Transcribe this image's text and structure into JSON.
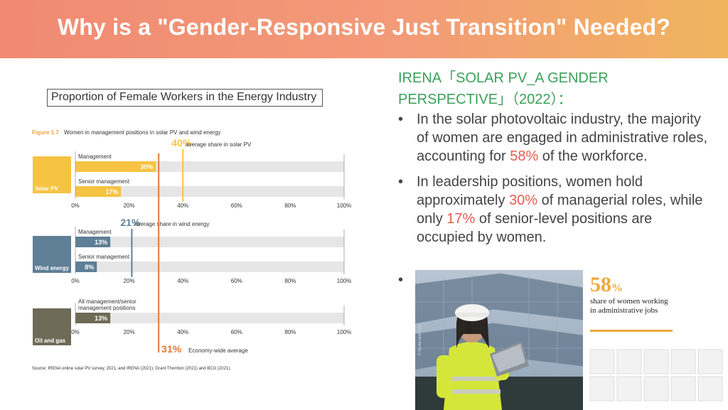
{
  "title": "Why is a \"Gender-Responsive Just Transition\" Needed?",
  "chart_box_title": "Proportion of Female Workers in the Energy Industry",
  "chart_data": {
    "type": "bar",
    "figure_label": "Figure 1.7",
    "title": "Women in management positions in solar PV and wind energy",
    "xlim": [
      0,
      100
    ],
    "ticks": [
      "0%",
      "20%",
      "40%",
      "60%",
      "80%",
      "100%"
    ],
    "groups": [
      {
        "name": "Solar PV",
        "color": "#f6c342",
        "bars": [
          {
            "category": "Management",
            "value": 30,
            "label": "30%"
          },
          {
            "category": "Senior management",
            "value": 17,
            "label": "17%"
          }
        ],
        "average": {
          "value": 40,
          "label": "40%",
          "text": "average share in solar PV",
          "color": "#f6c342"
        }
      },
      {
        "name": "Wind energy",
        "color": "#5e7f96",
        "bars": [
          {
            "category": "Management",
            "value": 13,
            "label": "13%"
          },
          {
            "category": "Senior management",
            "value": 8,
            "label": "8%"
          }
        ],
        "average": {
          "value": 21,
          "label": "21%",
          "text": "average share in wind energy",
          "color": "#5e7f96"
        }
      },
      {
        "name": "Oil and gas",
        "color": "#6e6a57",
        "bars": [
          {
            "category": "All management/senior\nmanagement positions",
            "value": 13,
            "label": "13%"
          }
        ]
      }
    ],
    "economy_average": {
      "value": 31,
      "label": "31%",
      "text": "Economy-wide average",
      "color": "#e07b39"
    },
    "source": "Source: IRENA online solar PV survey, 2021, and IRENA (2021); Grant Thornton (2021) and BCG (2021)."
  },
  "report_title": "IRENA「SOLAR PV_A GENDER PERSPECTIVE」（2022）：",
  "bullets": [
    {
      "before": "In the solar photovoltaic industry, the majority of women are engaged in administrative roles, accounting for ",
      "hl1": "58%",
      "mid": " of the workforce.",
      "hl2": "",
      "after": ""
    },
    {
      "before": "In leadership positions, women hold approximately ",
      "hl1": "30%",
      "mid": " of managerial roles, while only ",
      "hl2": "17%",
      "after": " of senior-level positions are occupied by women."
    }
  ],
  "bullet_symbol": "•",
  "infographic": {
    "stat_number": "58",
    "stat_unit": "%",
    "stat_text": "share of women working in administrative jobs",
    "credit": "© Shutterstock.com"
  },
  "colors": {
    "highlight": "#e85c52",
    "report_title": "#3aa05a",
    "accent": "#f0a93a"
  }
}
